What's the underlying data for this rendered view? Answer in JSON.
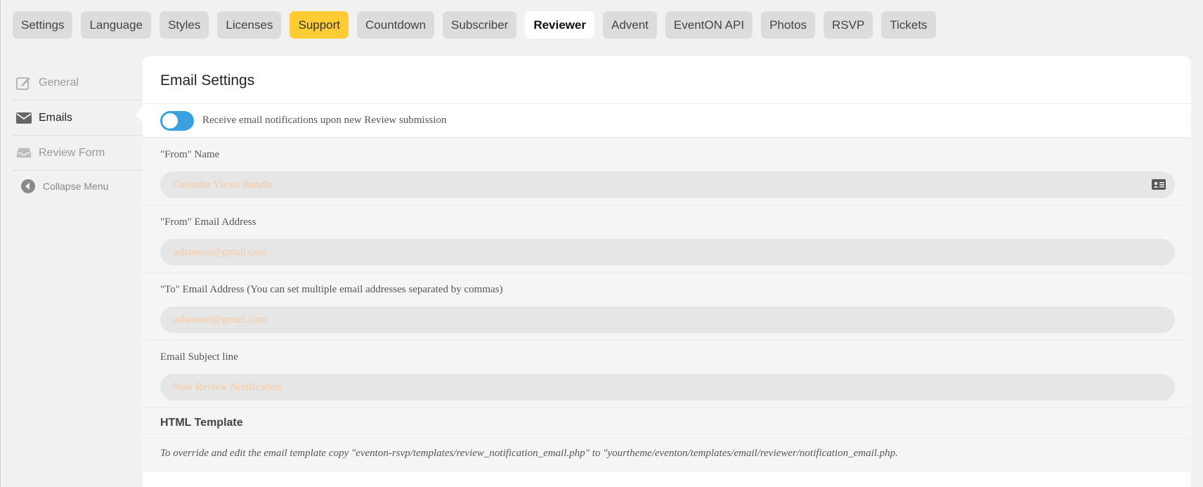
{
  "tabs": [
    "Settings",
    "Language",
    "Styles",
    "Licenses",
    "Support",
    "Countdown",
    "Subscriber",
    "Reviewer",
    "Advent",
    "EventON API",
    "Photos",
    "RSVP",
    "Tickets"
  ],
  "active_tab": "Reviewer",
  "sidebar": {
    "items": [
      {
        "label": "General",
        "icon": "edit-icon"
      },
      {
        "label": "Emails",
        "icon": "envelope-icon"
      },
      {
        "label": "Review Form",
        "icon": "inbox-icon"
      },
      {
        "label": "Collapse Menu",
        "icon": "collapse-icon"
      }
    ]
  },
  "panel": {
    "title": "Email Settings",
    "toggle_label": "Receive email notifications upon new Review submission",
    "fields": [
      {
        "label": "\"From\" Name",
        "placeholder": "Calendar Views Bundle"
      },
      {
        "label": "\"From\" Email Address",
        "placeholder": "ashanster@gmail.com"
      },
      {
        "label": "\"To\" Email Address (You can set multiple email addresses separated by commas)",
        "placeholder": "ashanster@gmail.com"
      },
      {
        "label": "Email Subject line",
        "placeholder": "New Review Notification"
      }
    ],
    "template_heading": "HTML Template",
    "template_note": "To override and edit the email template copy \"eventon-rsvp/templates/review_notification_email.php\" to \"yourtheme/eventon/templates/email/reviewer/notification_email.php."
  },
  "colors": {
    "support_tab": "#ffcc33",
    "toggle_on": "#3aa1e0",
    "placeholder": "#f7c8a0"
  }
}
